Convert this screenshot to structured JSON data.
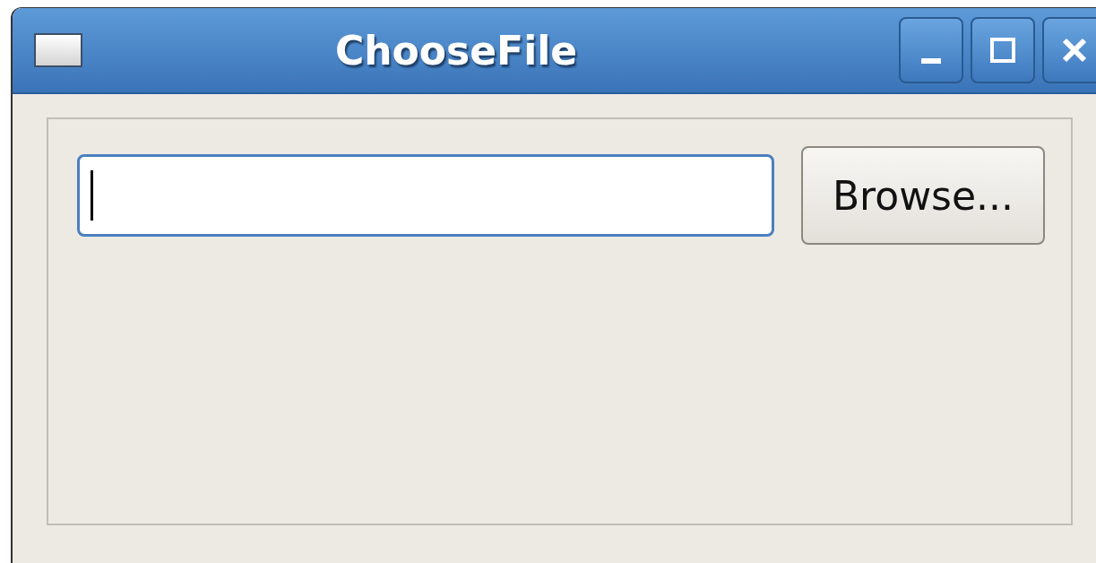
{
  "window": {
    "title": "ChooseFile",
    "controls": [
      {
        "kind": "minimize"
      },
      {
        "kind": "maximize"
      },
      {
        "kind": "close"
      }
    ]
  },
  "file_field": {
    "focused": true
  },
  "browse_button": {
    "label": "Browse..."
  }
}
